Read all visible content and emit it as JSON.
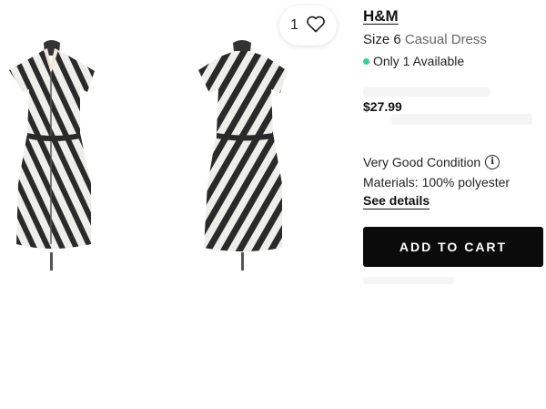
{
  "product": {
    "brand": "H&M",
    "size_label": "Size 6",
    "category": "Casual Dress",
    "availability": "Only 1 Available",
    "price": "$27.99",
    "condition": "Very Good Condition",
    "materials": "Materials: 100% polyester",
    "details_link": "See details"
  },
  "favorites": {
    "count": "1"
  },
  "actions": {
    "add_to_cart": "ADD TO CART"
  },
  "colors": {
    "available_dot": "#3ccf91",
    "button_bg": "#0b0b0b",
    "dress_dark": "#2a2a2a",
    "dress_light": "#eeeeea"
  },
  "icons": {
    "favorite": "heart-icon",
    "condition_info": "info-icon",
    "availability": "status-dot-icon"
  }
}
